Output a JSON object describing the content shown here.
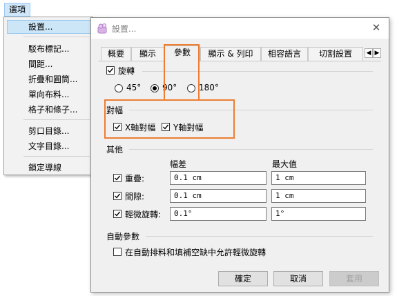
{
  "menubar": {
    "options_label": "選項"
  },
  "menu": {
    "items": [
      "設置...",
      "駁布標記...",
      "間距...",
      "折疊和圓筒...",
      "單向布料...",
      "格子和條子...",
      "剪口目錄...",
      "文字目錄...",
      "鎖定導線"
    ]
  },
  "dialog": {
    "title": "設置...",
    "tabs": [
      "概要",
      "顯示",
      "參數",
      "顯示 & 列印",
      "相容語言",
      "切割設置"
    ],
    "active_tab": "參數",
    "rotation": {
      "label": "旋轉",
      "checked": true,
      "options": [
        "45°",
        "90°",
        "180°"
      ],
      "selected": "90°"
    },
    "align": {
      "label": "對幅",
      "x_label": "X軸對幅",
      "y_label": "Y軸對幅",
      "x_checked": true,
      "y_checked": true
    },
    "other": {
      "label": "其他",
      "col_tolerance": "幅差",
      "col_max": "最大值",
      "rows": [
        {
          "label": "重疊:",
          "checked": true,
          "tolerance": "0.1 cm",
          "max": "1 cm"
        },
        {
          "label": "間隙:",
          "checked": true,
          "tolerance": "0.1 cm",
          "max": "1 cm"
        },
        {
          "label": "輕微旋轉:",
          "checked": true,
          "tolerance": "0.1°",
          "max": "1°"
        }
      ]
    },
    "auto": {
      "label": "自動參數",
      "allow_label": "在自動排料和填補空缺中允許輕微旋轉",
      "allow_checked": false
    },
    "buttons": {
      "ok": "確定",
      "cancel": "取消",
      "apply": "套用"
    }
  },
  "colors": {
    "highlight_box": "#ed7d31",
    "menu_highlight": "#cde6f7"
  }
}
